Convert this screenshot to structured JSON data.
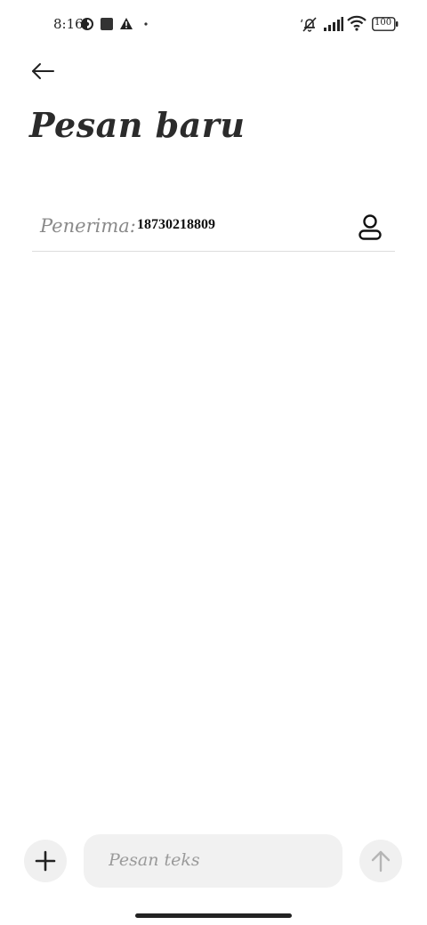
{
  "status_bar": {
    "time": "8:16",
    "battery_level": "100",
    "icons": [
      "data-saver-icon",
      "square-notification-icon",
      "warning-icon",
      "dot-icon",
      "mute-icon",
      "signal-icon",
      "wifi-icon",
      "battery-icon"
    ]
  },
  "header": {
    "title": "Pesan baru",
    "back_icon": "arrow-left-icon"
  },
  "recipient": {
    "label": "Penerima:",
    "value": "18730218809",
    "contact_icon": "person-icon"
  },
  "composer": {
    "placeholder": "Pesan teks",
    "attach_icon": "plus-icon",
    "send_icon": "arrow-up-icon"
  },
  "colors": {
    "text": "#222222",
    "muted": "#8a8a8a",
    "input_bg": "#f1f1f1",
    "divider": "#dddddd"
  }
}
